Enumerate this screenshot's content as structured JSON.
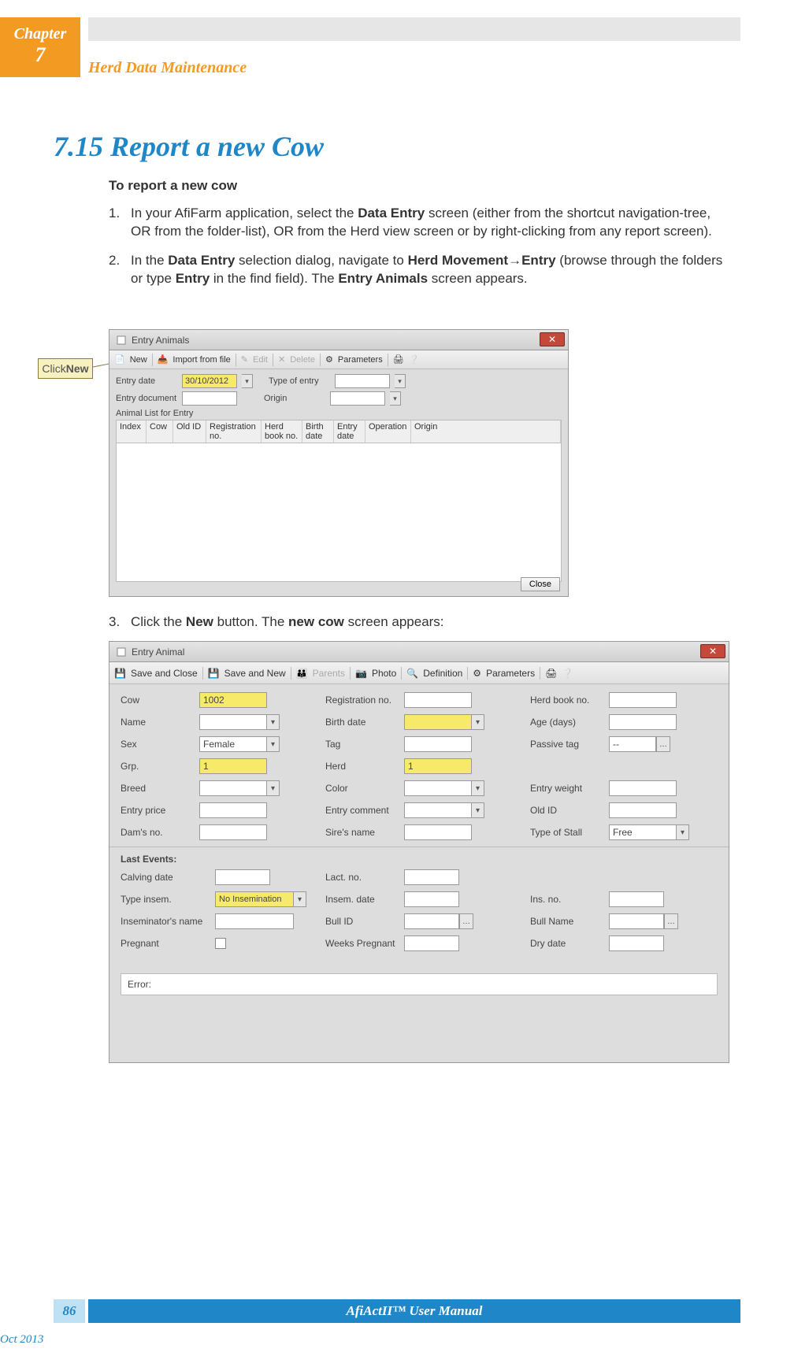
{
  "chapter": {
    "label": "Chapter",
    "num": "7"
  },
  "header_title": "Herd Data Maintenance",
  "section_number": "7.15",
  "section_title": "Report a new Cow",
  "subhead": "To report a new cow",
  "steps": {
    "s1": {
      "n": "1.",
      "pre": "In your AfiFarm application, select the ",
      "b1": "Data Entry",
      "mid": " screen (either from the shortcut navigation-tree, OR from the folder-list), OR from the Herd view screen or by right-clicking from any report screen)."
    },
    "s2": {
      "n": "2.",
      "pre": "In the ",
      "b1": "Data Entry",
      "mid1": " selection dialog, navigate to ",
      "b2": "Herd Movement",
      "arrow": "→",
      "b3": "Entry",
      "mid2": " (browse through the folders or type ",
      "b4": "Entry",
      "mid3": " in the find field). The ",
      "b5": "Entry Animals",
      "post": " screen appears."
    },
    "s3": {
      "n": "3.",
      "pre": "Click the ",
      "b1": "New",
      "mid": " button. The ",
      "b2": "new cow",
      "post": " screen appears:"
    }
  },
  "callout": {
    "pre": "Click ",
    "b": "New"
  },
  "shot1": {
    "title": "Entry Animals",
    "tb": {
      "new": "New",
      "import": "Import from file",
      "edit": "Edit",
      "delete": "Delete",
      "params": "Parameters"
    },
    "lblEntryDate": "Entry date",
    "valEntryDate": "30/10/2012",
    "lblType": "Type of entry",
    "lblDoc": "Entry document",
    "lblOrigin": "Origin",
    "listCaption": "Animal List for Entry",
    "cols": {
      "c1": "Index",
      "c2": "Cow",
      "c3": "Old ID",
      "c4": "Registration no.",
      "c5": "Herd book no.",
      "c6": "Birth date",
      "c7": "Entry date",
      "c8": "Operation",
      "c9": "Origin"
    },
    "close": "Close"
  },
  "shot2": {
    "title": "Entry Animal",
    "tb": {
      "saveclose": "Save and Close",
      "savenew": "Save and New",
      "parents": "Parents",
      "photo": "Photo",
      "def": "Definition",
      "params": "Parameters"
    },
    "fields": {
      "cow": "Cow",
      "cowVal": "1002",
      "regno": "Registration no.",
      "herdbook": "Herd book no.",
      "name": "Name",
      "birth": "Birth date",
      "age": "Age (days)",
      "sex": "Sex",
      "sexVal": "Female",
      "tag": "Tag",
      "ptag": "Passive tag",
      "ptagVal": "--",
      "grp": "Grp.",
      "grpVal": "1",
      "herd": "Herd",
      "herdVal": "1",
      "breed": "Breed",
      "color": "Color",
      "eweight": "Entry weight",
      "eprice": "Entry price",
      "ecomment": "Entry comment",
      "oldid": "Old ID",
      "damno": "Dam's no.",
      "sirename": "Sire's name",
      "stall": "Type of Stall",
      "stallVal": "Free"
    },
    "lastEvents": "Last Events:",
    "ev": {
      "calving": "Calving date",
      "lactno": "Lact. no.",
      "typeinsem": "Type insem.",
      "typeinsemVal": "No Insemination",
      "insemdate": "Insem. date",
      "insno": "Ins. no.",
      "insname": "Inseminator's name",
      "bullid": "Bull ID",
      "bullname": "Bull Name",
      "pregnant": "Pregnant",
      "weeksp": "Weeks Pregnant",
      "drydate": "Dry date"
    },
    "error": "Error:"
  },
  "footer": {
    "page": "86",
    "title_pre": "AfiAct ",
    "title_mid": "II",
    "title_post": "™ User Manual",
    "date": "Oct 2013"
  }
}
